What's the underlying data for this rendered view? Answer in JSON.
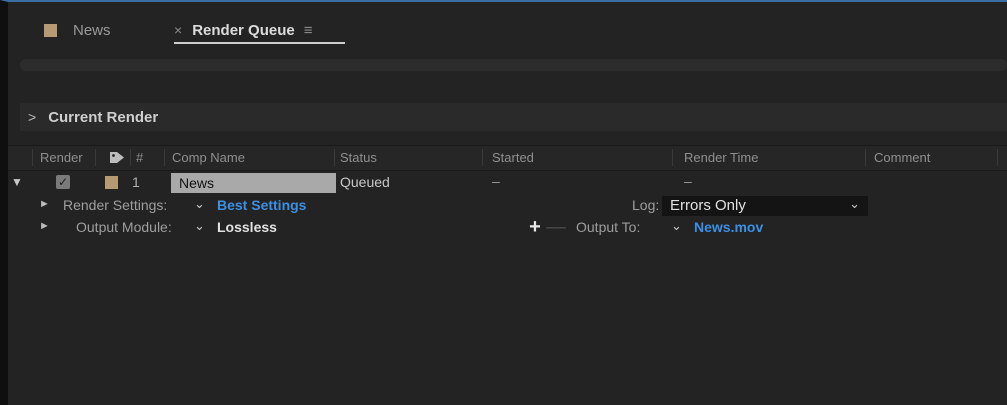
{
  "tabs": {
    "news_label": "News",
    "render_queue_label": "Render Queue",
    "close_glyph": "×",
    "menu_glyph": "≡"
  },
  "current_render": {
    "chevron": ">",
    "label": "Current Render"
  },
  "columns": {
    "render": "Render",
    "number": "#",
    "comp_name": "Comp Name",
    "status": "Status",
    "started": "Started",
    "render_time": "Render Time",
    "comment": "Comment"
  },
  "queue_item": {
    "expand_glyph": "▼",
    "checked_glyph": "✓",
    "number": "1",
    "comp_name": "News",
    "status": "Queued",
    "started": "–",
    "render_time": "–"
  },
  "render_settings": {
    "label": "Render Settings:",
    "value": "Best Settings",
    "log_label": "Log:",
    "log_value": "Errors Only"
  },
  "output_module": {
    "label": "Output Module:",
    "value": "Lossless",
    "plus": "+",
    "minus": "—",
    "output_to_label": "Output To:",
    "output_to_value": "News.mov"
  },
  "glyphs": {
    "dropdown": "⌄",
    "expand_arrow": "►"
  },
  "colors": {
    "accent_blue": "#3d8fe4",
    "comp_label": "#b59a74"
  }
}
